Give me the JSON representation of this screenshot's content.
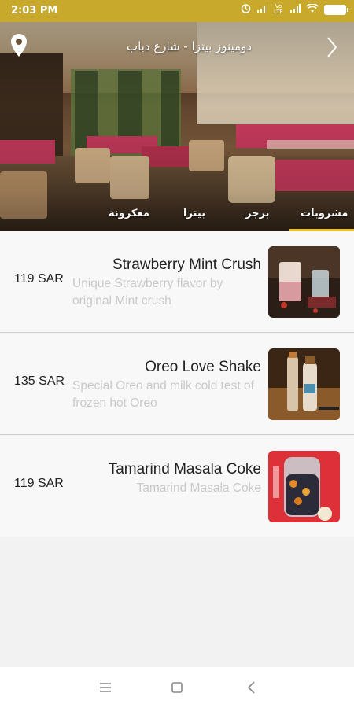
{
  "status_bar": {
    "time": "2:03 PM",
    "icons": [
      "alarm-icon",
      "signal-icon",
      "volte-icon",
      "signal-icon",
      "wifi-icon",
      "battery-icon"
    ],
    "volte_label": "Vo LTE"
  },
  "header": {
    "title": "دومينوز بيتزا - شارع دباب",
    "icons": [
      "location-pin-icon",
      "chevron-right-icon"
    ]
  },
  "tabs": [
    {
      "label": "مشروبات",
      "active": true
    },
    {
      "label": "برجر",
      "active": false
    },
    {
      "label": "بيتزا",
      "active": false
    },
    {
      "label": "معكرونة",
      "active": false
    }
  ],
  "items": [
    {
      "name": "Strawberry Mint Crush",
      "description": "Unique Strawberry flavor by original Mint crush",
      "price": "119 SAR"
    },
    {
      "name": "Oreo Love Shake",
      "description": "Special Oreo and milk cold test of frozen hot Oreo",
      "price": "135 SAR"
    },
    {
      "name": "Tamarind Masala Coke",
      "description": "Tamarind Masala Coke",
      "price": "119 SAR"
    }
  ],
  "colors": {
    "status_bar": "#c8a92c",
    "accent": "#f2c21b",
    "description_text": "#c9c9c9"
  },
  "navbar": {
    "icons": [
      "menu-icon",
      "home-square-icon",
      "back-icon"
    ]
  }
}
